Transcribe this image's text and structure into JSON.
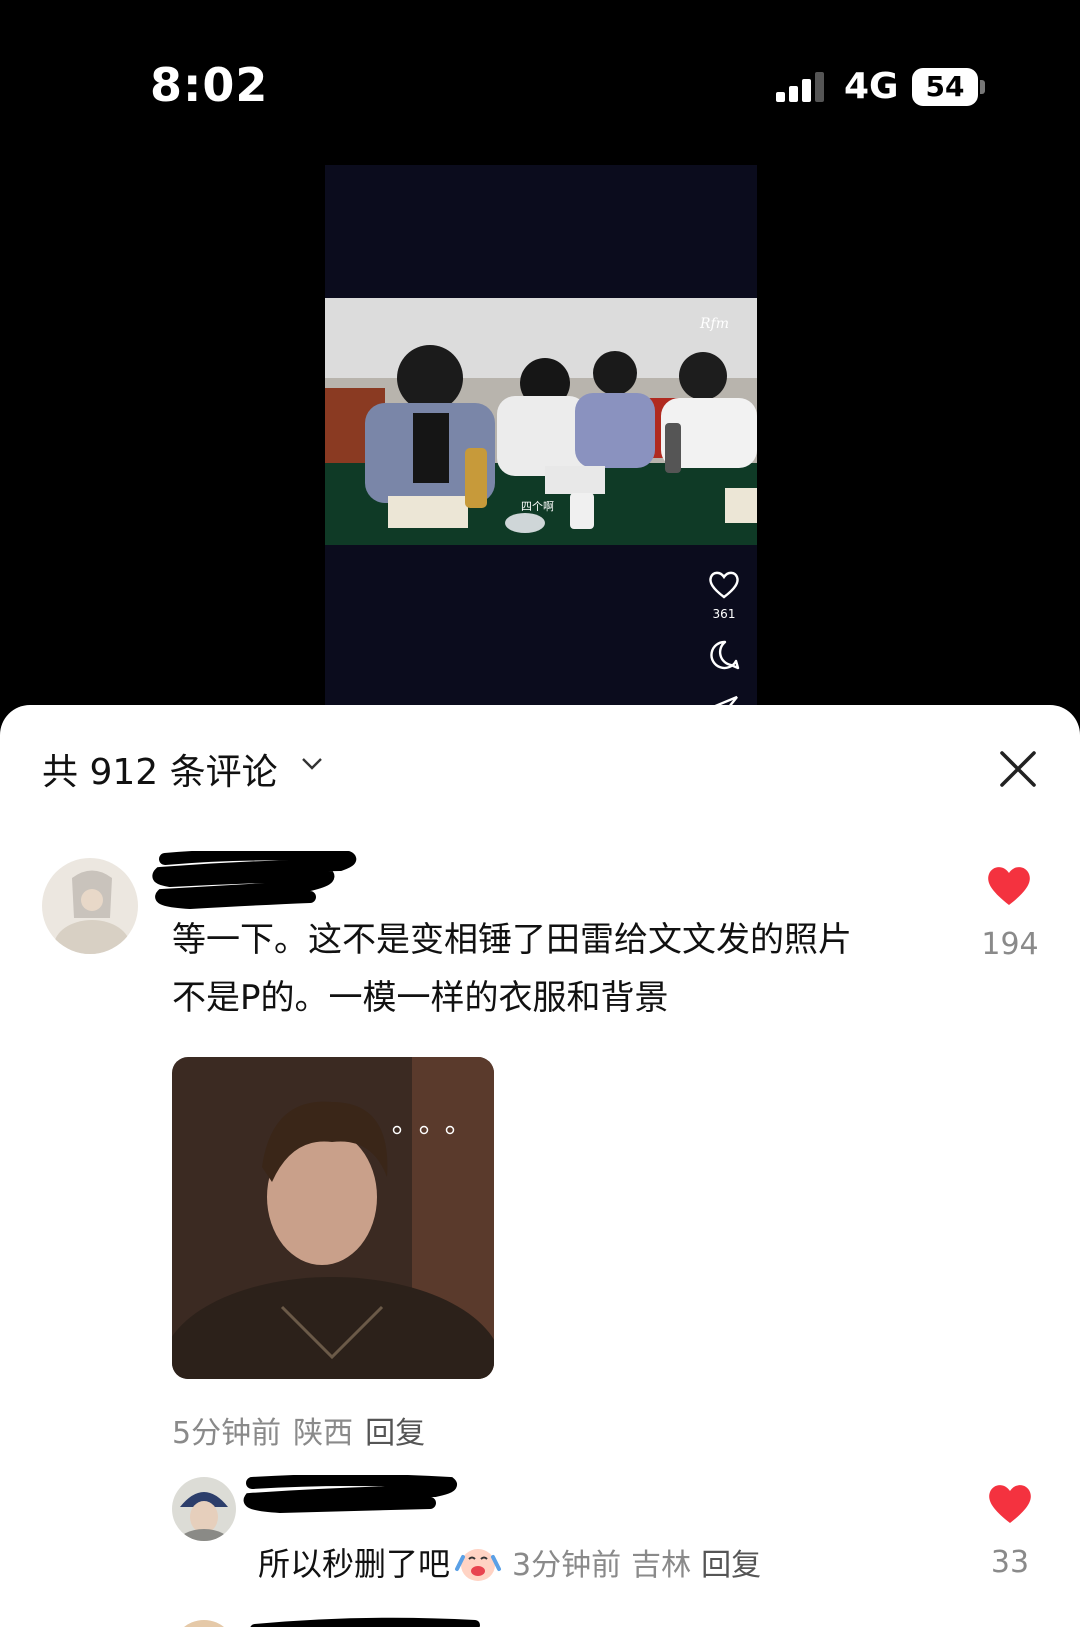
{
  "status_bar": {
    "time": "8:02",
    "network": "4G",
    "battery": "54"
  },
  "video": {
    "caption": "四个啊",
    "like_count": "361",
    "icons": [
      "heart-icon",
      "comment-icon",
      "share-icon"
    ]
  },
  "comments_panel": {
    "title": "共 912 条评论",
    "comments": [
      {
        "text_line1": "等一下。这不是变相锤了田雷给文文发的照片",
        "text_line2": "不是P的。一模一样的衣服和背景",
        "time": "5分钟前",
        "location": "陕西",
        "reply_label": "回复",
        "likes": "194"
      }
    ],
    "replies": [
      {
        "text": "所以秒删了吧",
        "time": "3分钟前",
        "location": "吉林",
        "reply_label": "回复",
        "likes": "33"
      }
    ]
  },
  "colors": {
    "like": "#f4323f",
    "muted_text": "#8a8a8a",
    "panel_bg": "#ffffff",
    "top_bg": "#000000"
  }
}
